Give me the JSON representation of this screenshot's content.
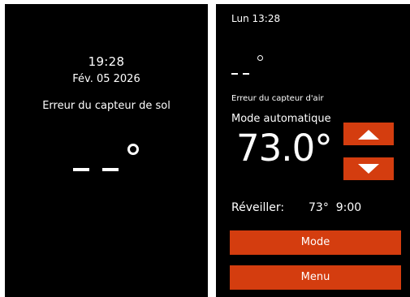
{
  "left_screen": {
    "time": "19:28",
    "date": "Fév. 05 2026",
    "error_message": "Erreur du capteur de sol",
    "temperature_display": "_ _ °"
  },
  "right_screen": {
    "clock": "Lun 13:28",
    "air_temperature_display": "_ _ °",
    "error_message": "Erreur du capteur d'air",
    "mode_label": "Mode automatique",
    "setpoint": "73.0°",
    "wake": {
      "label": "Réveiller:",
      "value": "73°  9:00"
    },
    "mode_button_label": "Mode",
    "menu_button_label": "Menu"
  },
  "colors": {
    "screen_background": "#000000",
    "text": "#ffffff",
    "accent": "#d43d0f",
    "page_background": "#ffffff"
  },
  "icons": {
    "up": "triangle-up-icon",
    "down": "triangle-down-icon"
  }
}
